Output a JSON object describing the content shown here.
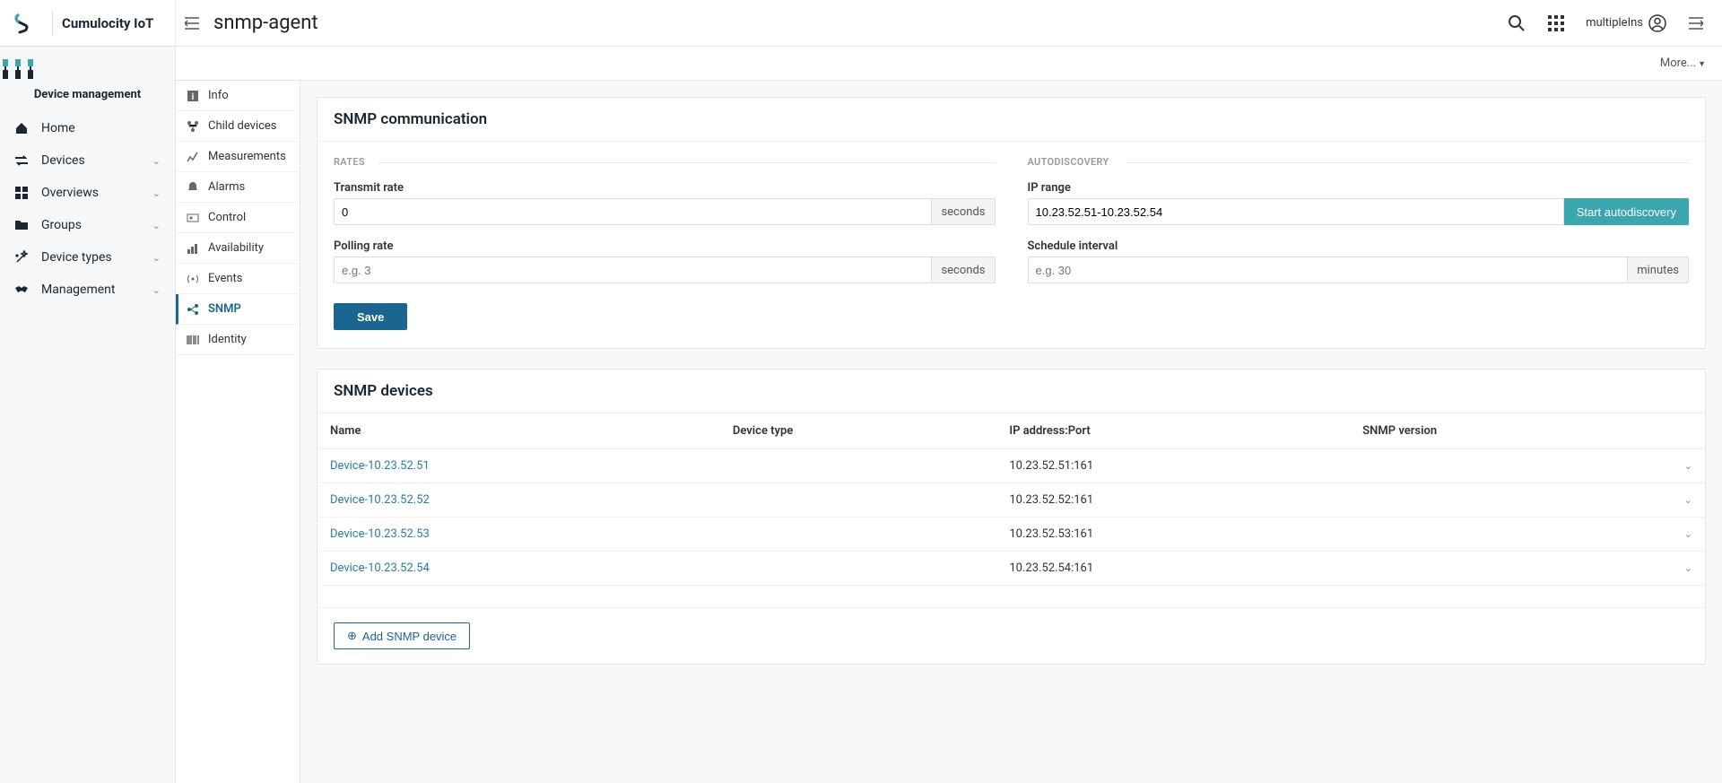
{
  "brand": {
    "title": "Cumulocity IoT"
  },
  "sidebar": {
    "heading": "Device management",
    "items": [
      {
        "label": "Home",
        "icon": "home",
        "expandable": false
      },
      {
        "label": "Devices",
        "icon": "arrows",
        "expandable": true
      },
      {
        "label": "Overviews",
        "icon": "dashboard",
        "expandable": true
      },
      {
        "label": "Groups",
        "icon": "folder",
        "expandable": true
      },
      {
        "label": "Device types",
        "icon": "wand",
        "expandable": true
      },
      {
        "label": "Management",
        "icon": "handshake",
        "expandable": true
      }
    ]
  },
  "header": {
    "page_title": "snmp-agent",
    "more_label": "More...",
    "username": "multipleIns"
  },
  "tabs": [
    {
      "label": "Info",
      "icon": "info"
    },
    {
      "label": "Child devices",
      "icon": "branch"
    },
    {
      "label": "Measurements",
      "icon": "chart"
    },
    {
      "label": "Alarms",
      "icon": "bell"
    },
    {
      "label": "Control",
      "icon": "control"
    },
    {
      "label": "Availability",
      "icon": "bars"
    },
    {
      "label": "Events",
      "icon": "broadcast"
    },
    {
      "label": "SNMP",
      "icon": "nodes",
      "active": true
    },
    {
      "label": "Identity",
      "icon": "barcode"
    }
  ],
  "snmp_comm": {
    "title": "SNMP communication",
    "rates_legend": "RATES",
    "autodiscovery_legend": "AUTODISCOVERY",
    "transmit_label": "Transmit rate",
    "transmit_value": "0",
    "transmit_unit": "seconds",
    "polling_label": "Polling rate",
    "polling_placeholder": "e.g. 3",
    "polling_unit": "seconds",
    "ip_range_label": "IP range",
    "ip_range_value": "10.23.52.51-10.23.52.54",
    "start_auto_label": "Start autodiscovery",
    "schedule_label": "Schedule interval",
    "schedule_placeholder": "e.g. 30",
    "schedule_unit": "minutes",
    "save_label": "Save"
  },
  "snmp_devices": {
    "title": "SNMP devices",
    "columns": {
      "name": "Name",
      "device_type": "Device type",
      "ip": "IP address:Port",
      "version": "SNMP version"
    },
    "rows": [
      {
        "name": "Device-10.23.52.51",
        "device_type": "",
        "ip": "10.23.52.51:161",
        "version": ""
      },
      {
        "name": "Device-10.23.52.52",
        "device_type": "",
        "ip": "10.23.52.52:161",
        "version": ""
      },
      {
        "name": "Device-10.23.52.53",
        "device_type": "",
        "ip": "10.23.52.53:161",
        "version": ""
      },
      {
        "name": "Device-10.23.52.54",
        "device_type": "",
        "ip": "10.23.52.54:161",
        "version": ""
      }
    ],
    "add_label": "Add SNMP device"
  }
}
